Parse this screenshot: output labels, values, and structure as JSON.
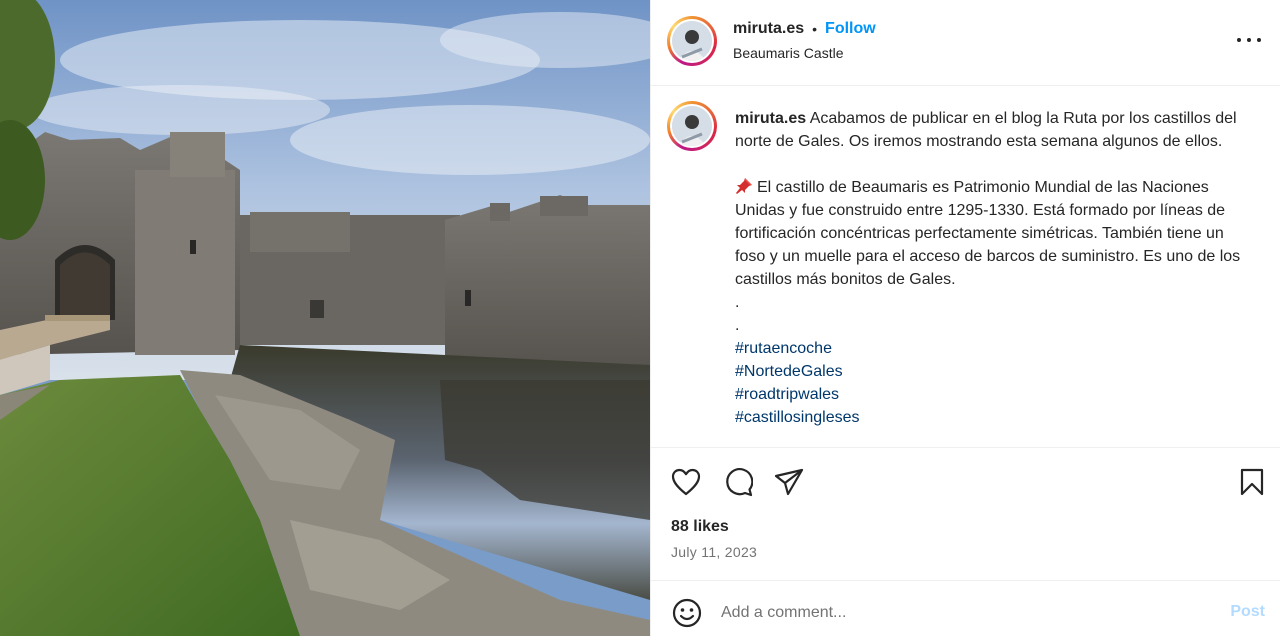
{
  "post": {
    "image_alt": "Beaumaris Castle with moat",
    "username": "miruta.es",
    "separator": "•",
    "follow_label": "Follow",
    "location": "Beaumaris Castle",
    "more_icon": "more-horizontal-icon"
  },
  "caption": {
    "username": "miruta.es",
    "intro": "Acabamos de publicar en el blog la Ruta por los castillos del norte de Gales. Os iremos mostrando esta semana algunos de ellos.",
    "pin_icon": "pushpin-icon",
    "body": "El castillo de Beaumaris es Patrimonio Mundial de las Naciones Unidas y fue construido entre 1295-1330. Está formado por líneas de fortificación concéntricas perfectamente simétricas. También tiene un foso y un muelle para el acceso de barcos de suministro. Es uno de los castillos más bonitos de Gales.",
    "dots": [
      ".",
      "."
    ],
    "hashtags": [
      "#rutaencoche",
      "#NortedeGales",
      "#roadtripwales",
      "#castillosingleses"
    ]
  },
  "actions": {
    "like_icon": "heart-icon",
    "comment_icon": "comment-icon",
    "share_icon": "share-icon",
    "save_icon": "bookmark-icon"
  },
  "stats": {
    "likes": "88 likes",
    "date": "July 11, 2023"
  },
  "comment_box": {
    "emoji_icon": "emoji-icon",
    "placeholder": "Add a comment...",
    "post_label": "Post"
  },
  "colors": {
    "link_blue": "#0095f6",
    "hashtag_blue": "#00376b",
    "post_disabled": "#b3dbff"
  }
}
